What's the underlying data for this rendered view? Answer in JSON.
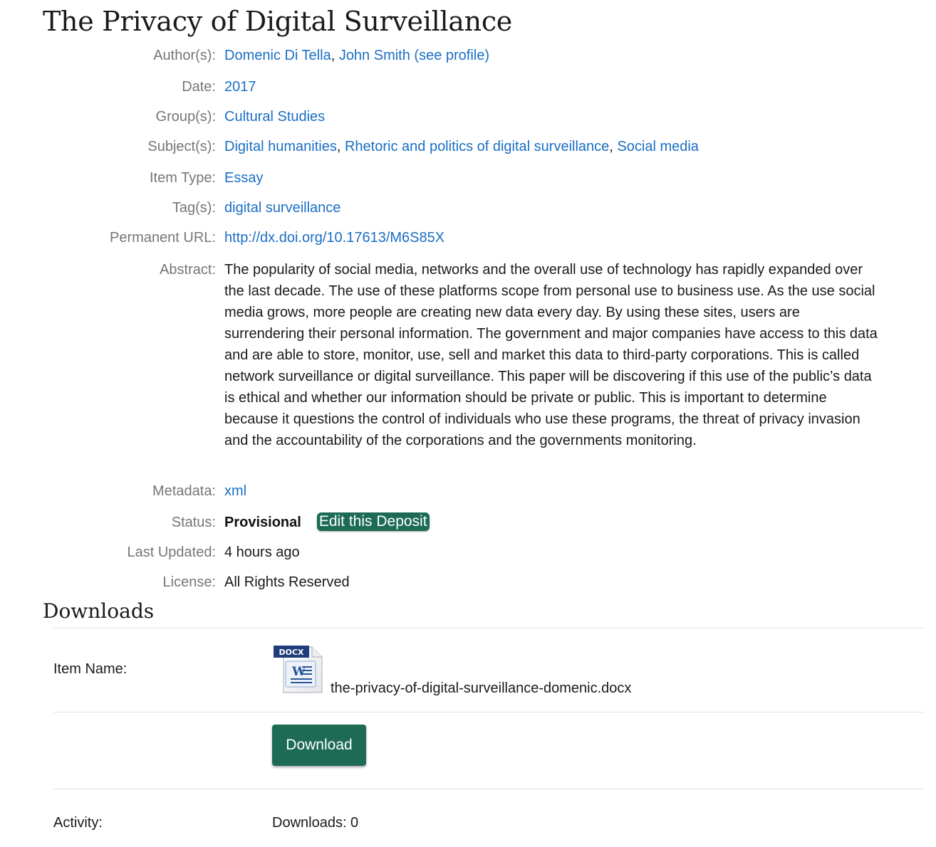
{
  "page": {
    "title": "The Privacy of Digital Surveillance"
  },
  "meta": {
    "authors_label": "Author(s):",
    "authors": [
      "Domenic Di Tella",
      "John Smith (see profile)"
    ],
    "date_label": "Date:",
    "date": "2017",
    "groups_label": "Group(s):",
    "groups": [
      "Cultural Studies"
    ],
    "subjects_label": "Subject(s):",
    "subjects": [
      "Digital humanities",
      "Rhetoric and politics of digital surveillance",
      "Social media"
    ],
    "item_type_label": "Item Type:",
    "item_type": "Essay",
    "tags_label": "Tag(s):",
    "tags": [
      "digital surveillance"
    ],
    "url_label": "Permanent URL:",
    "url": "http://dx.doi.org/10.17613/M6S85X",
    "abstract_label": "Abstract:",
    "abstract": "The popularity of social media, networks and the overall use of technology has rapidly expanded over the last decade. The use of these platforms scope from personal use to business use. As the use social media grows, more people are creating new data every day. By using these sites, users are surrendering their personal information. The government and major companies have access to this data and are able to store, monitor, use, sell and market this data to third-party corporations. This is called network surveillance or digital surveillance. This paper will be discovering if this use of the public’s data is ethical and whether our information should be private or public. This is important to determine because it questions the control of individuals who use these programs, the threat of privacy invasion and the accountability of the corporations and the governments monitoring.",
    "metadata_label": "Metadata:",
    "metadata_link": "xml",
    "status_label": "Status:",
    "status": "Provisional",
    "edit_button": "Edit this Deposit",
    "updated_label": "Last Updated:",
    "updated": "4 hours ago",
    "license_label": "License:",
    "license": "All Rights Reserved"
  },
  "downloads": {
    "section_title": "Downloads",
    "item_name_label": "Item Name:",
    "file_badge": "DOCX",
    "file_name": "the-privacy-of-digital-surveillance-domenic.docx",
    "download_button": "Download",
    "activity_label": "Activity:",
    "activity_value": "Downloads: 0"
  },
  "colors": {
    "link": "#1b6fc4",
    "label": "#767676",
    "button": "#1d6b54"
  },
  "icons": [
    "docx-file-icon"
  ]
}
